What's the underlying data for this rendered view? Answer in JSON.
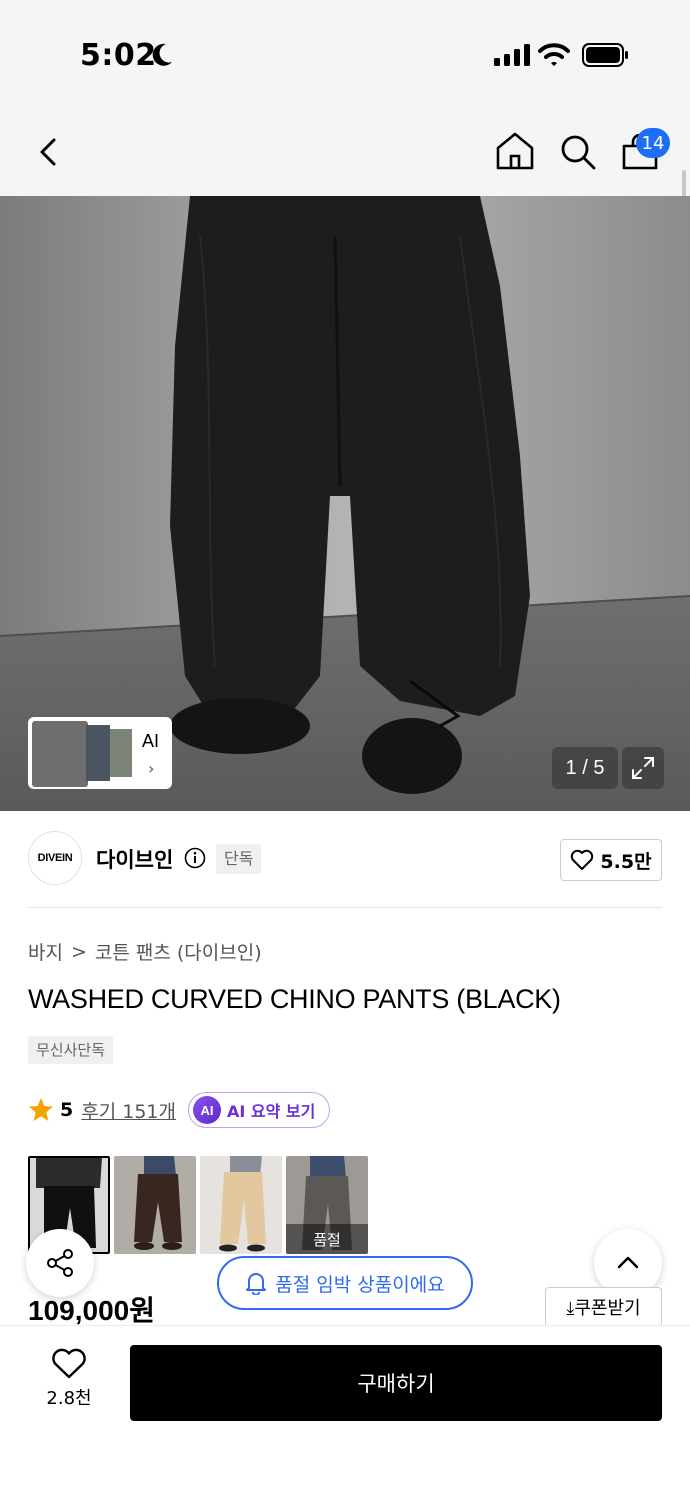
{
  "status_bar": {
    "time": "5:02"
  },
  "nav": {
    "cart_count": "14"
  },
  "gallery": {
    "ai_label": "AI",
    "ai_chevron": "›",
    "page_indicator": "1 / 5"
  },
  "brand": {
    "logo_text": "DIVEIN",
    "name": "다이브인",
    "badge": "단독",
    "likes": "5.5만"
  },
  "breadcrumb": {
    "category": "바지",
    "separator": ">",
    "subcategory": "코튼 팬츠 (다이브인)"
  },
  "product": {
    "title": "WASHED CURVED CHINO PANTS (BLACK)",
    "exclusive_tag": "무신사단독",
    "rating": "5",
    "review_link": "후기 151개",
    "ai_badge": "AI",
    "ai_summary": "AI 요약 보기",
    "price": "109,000원",
    "soldout_label": "품절"
  },
  "notice": {
    "low_stock": "품절 임박 상품이에요"
  },
  "coupon": {
    "label": "⤓쿠폰받기"
  },
  "bottom": {
    "like_count": "2.8천",
    "buy_label": "구매하기"
  },
  "colors": {
    "accent_blue": "#2f6af0",
    "badge_blue": "#1e6df6",
    "star": "#f5a300",
    "ai_purple": "#6a2fd6"
  },
  "icons": [
    "back-icon",
    "home-icon",
    "search-icon",
    "cart-icon",
    "expand-icon",
    "info-icon",
    "heart-icon",
    "star-icon",
    "share-icon",
    "bell-icon",
    "chevron-up-icon",
    "download-icon"
  ]
}
